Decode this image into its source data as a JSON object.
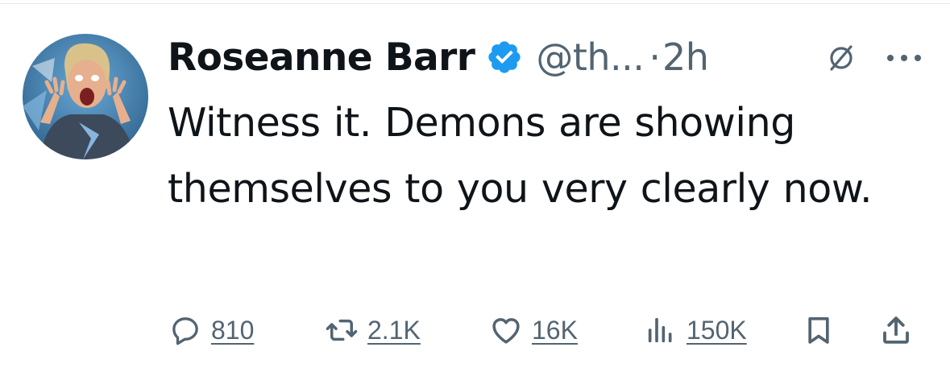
{
  "tweet": {
    "author_name": "Roseanne Barr",
    "handle": "@th...",
    "separator": "·",
    "time": "2h",
    "text": "Witness it. Demons are showing themselves to you very clearly now."
  },
  "icons": {
    "verified": "verified-badge-icon",
    "grok": "grok-icon",
    "more": "more-icon",
    "reply": "reply-icon",
    "retweet": "retweet-icon",
    "like": "heart-icon",
    "views": "views-icon",
    "bookmark": "bookmark-icon",
    "share": "share-icon"
  },
  "actions": {
    "replies": "810",
    "retweets": "2.1K",
    "likes": "16K",
    "views": "150K"
  },
  "colors": {
    "verified": "#1d9bf0",
    "text": "#0f1419",
    "secondary": "#536471"
  }
}
